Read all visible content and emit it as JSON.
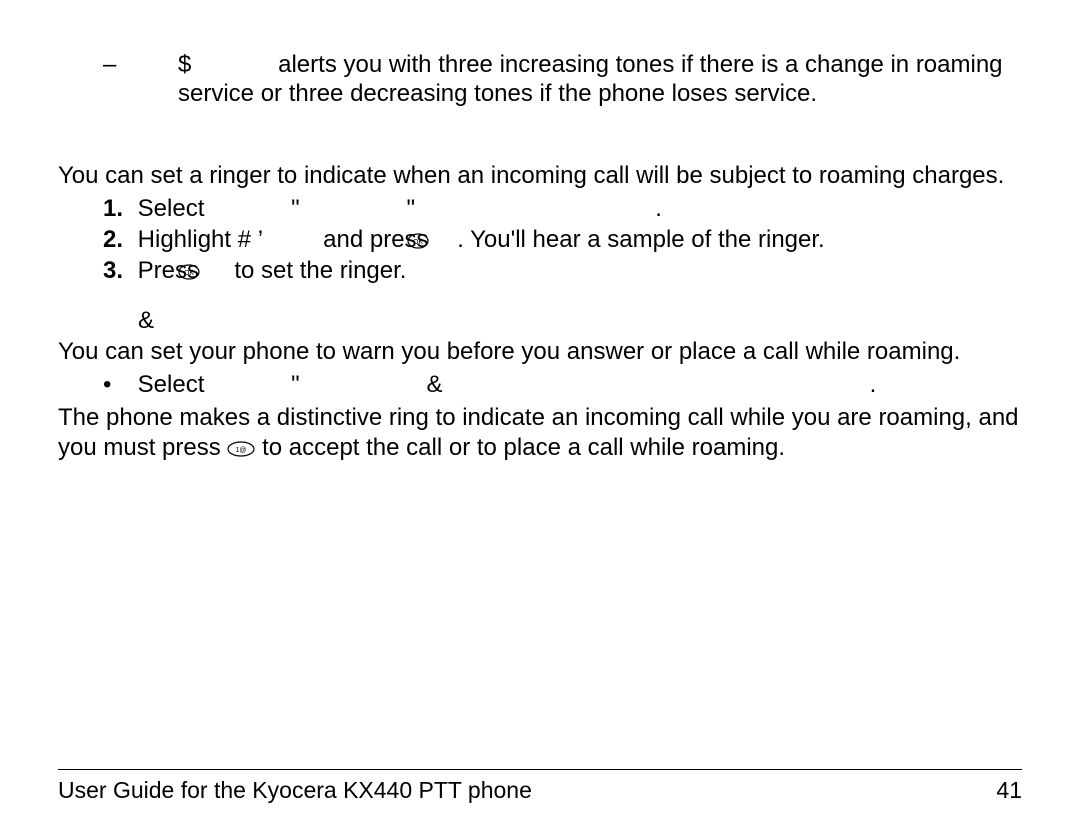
{
  "dash_item": {
    "lead_symbol": "$",
    "text": "alerts you with three increasing tones if there is a change in roaming service or three decreasing tones if the phone loses service."
  },
  "section_ringer": {
    "intro": "You can set a ringer to indicate when an incoming call will be subject to roaming charges.",
    "steps": {
      "s1_a": "Select ",
      "s1_b": "\"",
      "s1_c": "\"",
      "s1_end": ".",
      "s2_a": "Highlight #  ’",
      "s2_b": "and press ",
      "s2_c": ". You'll hear a sample of the ringer.",
      "s3_a": "Press ",
      "s3_b": " to set the ringer."
    }
  },
  "section_warn": {
    "heading_symbol": "&",
    "intro": "You can set your phone to warn you before you answer or place a call while roaming.",
    "bullet": {
      "a": "Select ",
      "b": "\"",
      "c": "&",
      "end": "."
    },
    "after_a": "The phone makes a distinctive ring to indicate an incoming call while you are roaming, and you must press ",
    "after_b": " to accept the call or to place a call while roaming."
  },
  "footer": {
    "title": "User Guide for the Kyocera KX440 PTT phone",
    "page": "41"
  },
  "icons": {
    "ok": "ok-icon",
    "key": "key-1-icon"
  }
}
